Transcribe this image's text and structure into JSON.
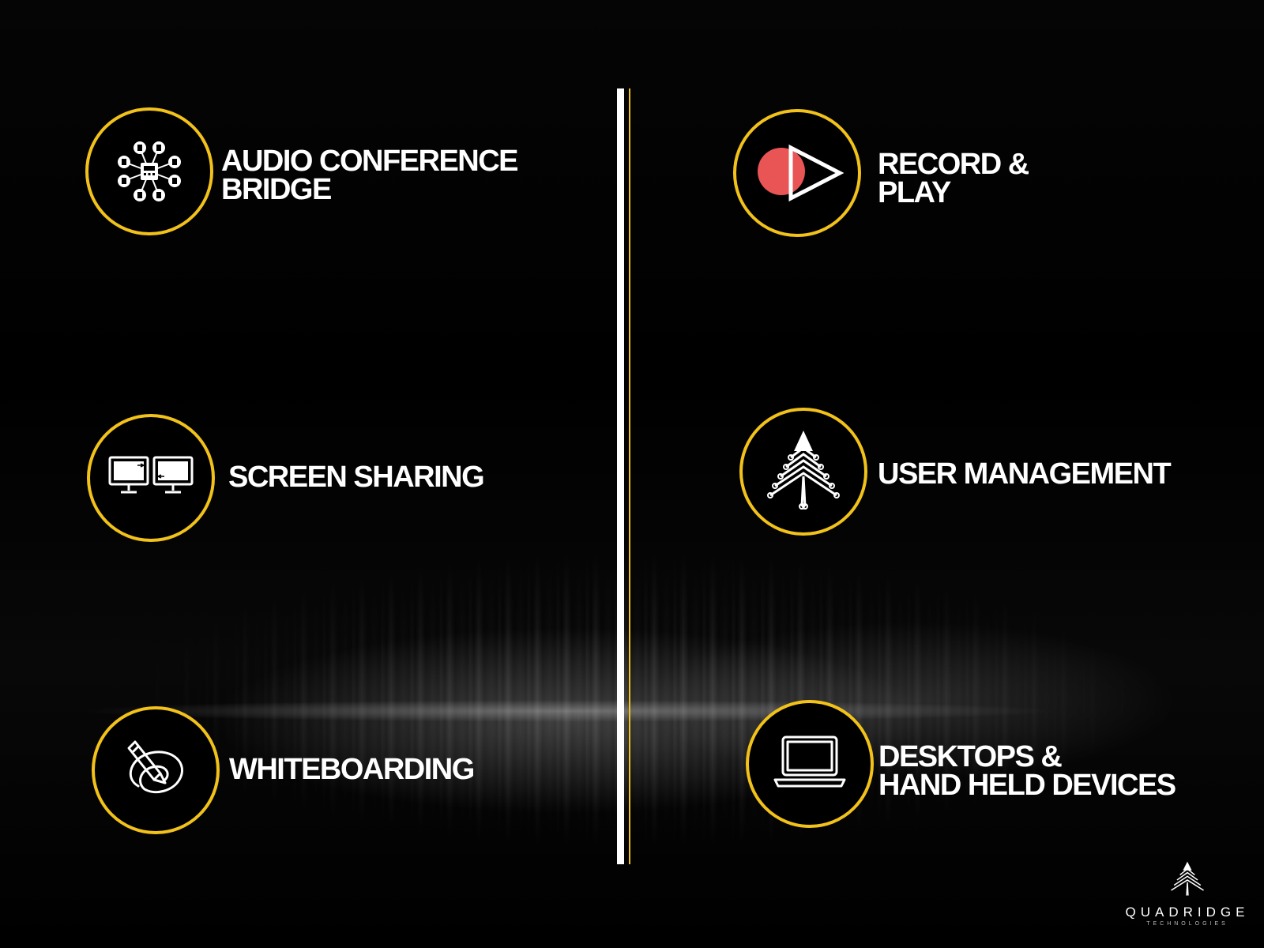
{
  "features": {
    "audio_conference": {
      "line1": "AUDIO CONFERENCE",
      "line2": "BRIDGE",
      "icon": "network-phone-icon"
    },
    "record_play": {
      "line1": "RECORD &",
      "line2": "PLAY",
      "icon": "record-play-icon"
    },
    "screen_sharing": {
      "line1": "SCREEN SHARING",
      "icon": "screen-sharing-icon"
    },
    "user_management": {
      "line1": "USER MANAGEMENT",
      "icon": "pyramid-icon"
    },
    "whiteboarding": {
      "line1": "WHITEBOARDING",
      "icon": "pencil-swirl-icon"
    },
    "devices": {
      "line1": "DESKTOPS &",
      "line2": "HAND HELD DEVICES",
      "icon": "laptop-icon"
    }
  },
  "logo": {
    "name": "QUADRIDGE",
    "tagline": "TECHNOLOGIES"
  },
  "colors": {
    "accent": "#f2c21b",
    "record": "#e95454",
    "background": "#000000",
    "text": "#ffffff"
  }
}
